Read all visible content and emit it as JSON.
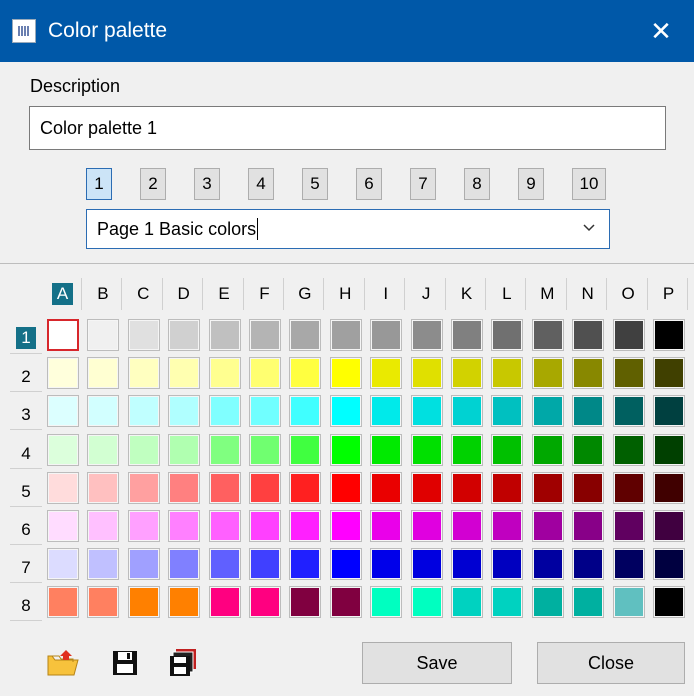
{
  "window": {
    "title": "Color palette",
    "close_glyph": "✕"
  },
  "description": {
    "label": "Description",
    "value": "Color palette 1"
  },
  "pages": {
    "buttons": [
      "1",
      "2",
      "3",
      "4",
      "5",
      "6",
      "7",
      "8",
      "9",
      "10"
    ],
    "active_index": 0,
    "selected_page": "Page 1 Basic colors"
  },
  "palette": {
    "columns": [
      "A",
      "B",
      "C",
      "D",
      "E",
      "F",
      "G",
      "H",
      "I",
      "J",
      "K",
      "L",
      "M",
      "N",
      "O",
      "P"
    ],
    "rows": [
      "1",
      "2",
      "3",
      "4",
      "5",
      "6",
      "7",
      "8"
    ],
    "active_column": "A",
    "active_row": "1",
    "selected_cell": "A1",
    "colors": [
      [
        "#ffffff",
        "#f0f0f0",
        "#e0e0e0",
        "#d0d0d0",
        "#c0c0c0",
        "#b4b4b4",
        "#a8a8a8",
        "#a0a0a0",
        "#989898",
        "#8c8c8c",
        "#808080",
        "#707070",
        "#606060",
        "#505050",
        "#404040",
        "#000000"
      ],
      [
        "#ffffdc",
        "#ffffd2",
        "#ffffc0",
        "#ffffb0",
        "#ffff90",
        "#ffff70",
        "#ffff40",
        "#ffff00",
        "#eaea00",
        "#e0e000",
        "#d2d200",
        "#c8c800",
        "#a8a800",
        "#888800",
        "#606000",
        "#404000"
      ],
      [
        "#dcffff",
        "#d2ffff",
        "#c0ffff",
        "#b0ffff",
        "#80ffff",
        "#70ffff",
        "#40ffff",
        "#00ffff",
        "#00eaea",
        "#00e0e0",
        "#00d2d2",
        "#00c0c0",
        "#00a8a8",
        "#008888",
        "#006060",
        "#004040"
      ],
      [
        "#dcffdc",
        "#d2ffd2",
        "#c0ffc0",
        "#b0ffb0",
        "#80ff80",
        "#70ff70",
        "#40ff40",
        "#00ff00",
        "#00ea00",
        "#00e000",
        "#00d200",
        "#00c000",
        "#00a800",
        "#008800",
        "#006000",
        "#004000"
      ],
      [
        "#ffdcdc",
        "#ffc0c0",
        "#ffa0a0",
        "#ff8080",
        "#ff6060",
        "#ff4040",
        "#ff2020",
        "#ff0000",
        "#ea0000",
        "#e00000",
        "#d20000",
        "#c00000",
        "#a00000",
        "#880000",
        "#600000",
        "#400000"
      ],
      [
        "#ffdcff",
        "#ffc0ff",
        "#ffa0ff",
        "#ff80ff",
        "#ff60ff",
        "#ff40ff",
        "#ff20ff",
        "#ff00ff",
        "#ea00ea",
        "#e000e0",
        "#d200d2",
        "#c000c0",
        "#a000a0",
        "#880088",
        "#600060",
        "#400040"
      ],
      [
        "#dcdcff",
        "#c0c0ff",
        "#a0a0ff",
        "#8080ff",
        "#6060ff",
        "#4040ff",
        "#2020ff",
        "#0000ff",
        "#0000ea",
        "#0000e0",
        "#0000d2",
        "#0000c0",
        "#0000a0",
        "#000088",
        "#000060",
        "#000040"
      ],
      [
        "#ff8060",
        "#ff8060",
        "#ff8000",
        "#ff8000",
        "#ff0080",
        "#ff0080",
        "#800040",
        "#800040",
        "#00ffc0",
        "#00ffc0",
        "#00d2c0",
        "#00d2c0",
        "#00b0a0",
        "#00b0a0",
        "#60c0c0",
        "#000000"
      ]
    ]
  },
  "footer": {
    "save_label": "Save",
    "close_label": "Close",
    "icons": [
      "open-folder-icon",
      "save-disk-icon",
      "save-all-icon"
    ]
  }
}
